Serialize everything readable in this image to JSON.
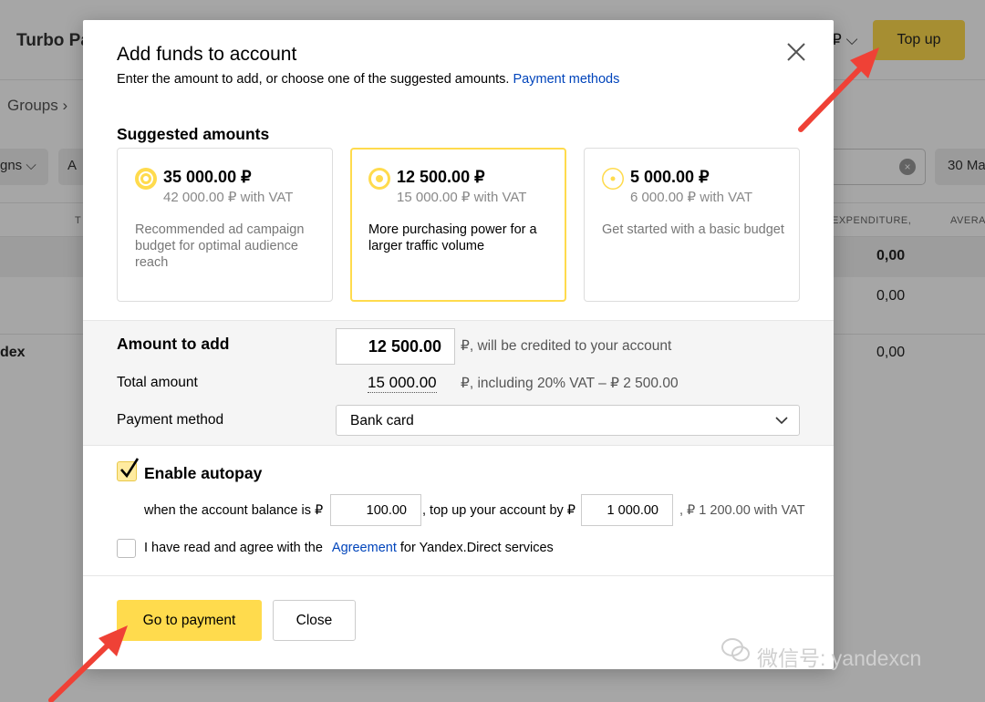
{
  "background": {
    "brand": "Turbo Pa",
    "currency": "₽",
    "top_up_label": "Top up",
    "breadcrumb": "Groups",
    "filters": [
      "gns",
      "A"
    ],
    "date_filter": "30 Ma",
    "columns": [
      "T",
      "EXPENDITURE,",
      "AVERA"
    ],
    "total_row_value": "0,00",
    "rows": [
      {
        "name": "",
        "value": "0,00"
      },
      {
        "name": "dex",
        "value": "0,00"
      }
    ]
  },
  "modal": {
    "title": "Add funds to account",
    "subtitle": "Enter the amount to add, or choose one of the suggested amounts.",
    "payment_methods_link": "Payment methods",
    "suggested_title": "Suggested amounts",
    "cards": [
      {
        "amount": "35 000.00 ₽",
        "vat": "42 000.00 ₽ with VAT",
        "desc": "Recommended ad campaign budget for optimal audience reach",
        "selected": false
      },
      {
        "amount": "12 500.00 ₽",
        "vat": "15 000.00 ₽ with VAT",
        "desc": "More purchasing power for a larger traffic volume",
        "selected": true
      },
      {
        "amount": "5 000.00 ₽",
        "vat": "6 000.00 ₽ with VAT",
        "desc": "Get started with a basic budget",
        "selected": false
      }
    ],
    "amount_label": "Amount to add",
    "amount_value": "12 500.00",
    "amount_note": "₽, will be credited to your account",
    "total_label": "Total amount",
    "total_value": "15 000.00",
    "total_note": "₽, including 20% VAT – ₽  2 500.00",
    "method_label": "Payment method",
    "method_value": "Bank card",
    "autopay_label": "Enable autopay",
    "autopay_checked": true,
    "autopay_when": "when the account balance is ₽",
    "autopay_threshold": "100.00",
    "autopay_topup": ", top up your account by ₽",
    "autopay_amount": "1 000.00",
    "autopay_vat": ", ₽ 1 200.00 with VAT",
    "agree_prefix": "I have read and agree with the",
    "agree_link": "Agreement",
    "agree_suffix": "for Yandex.Direct services",
    "pay_button": "Go to payment",
    "close_button": "Close"
  },
  "watermark": "微信号: yandexcn",
  "colors": {
    "accent": "#ffdb4d",
    "link": "#0044bb",
    "arrow": "#ef4136"
  }
}
